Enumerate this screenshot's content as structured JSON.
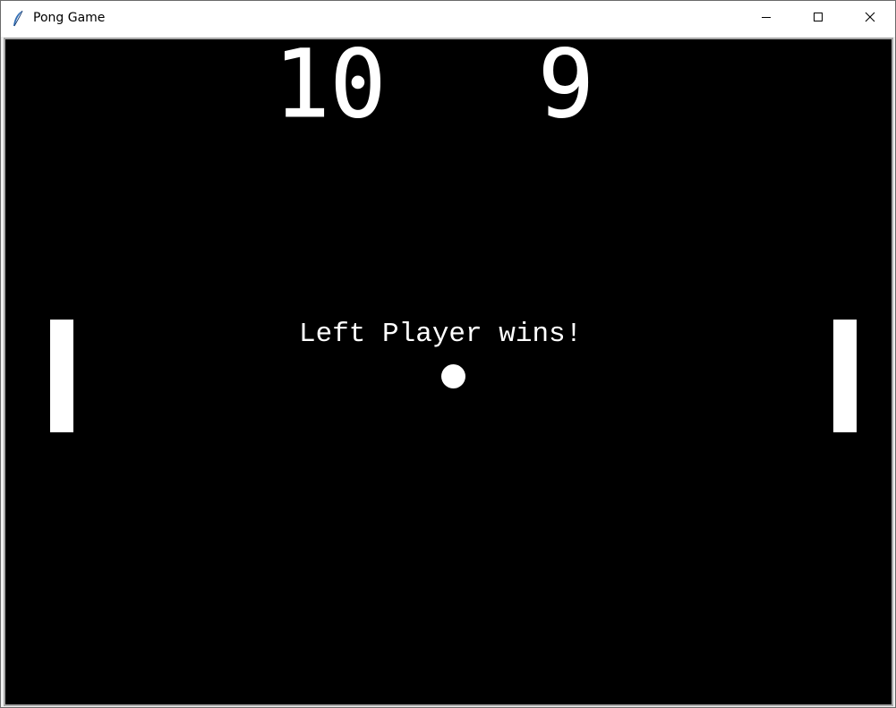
{
  "window": {
    "title": "Pong Game",
    "app_icon": "feather-icon",
    "controls": [
      "minimize-icon",
      "maximize-icon",
      "close-icon"
    ]
  },
  "game": {
    "score_left": "10",
    "score_right": "9",
    "message": "Left Player wins!",
    "background_color": "#000000",
    "foreground_color": "#ffffff"
  }
}
